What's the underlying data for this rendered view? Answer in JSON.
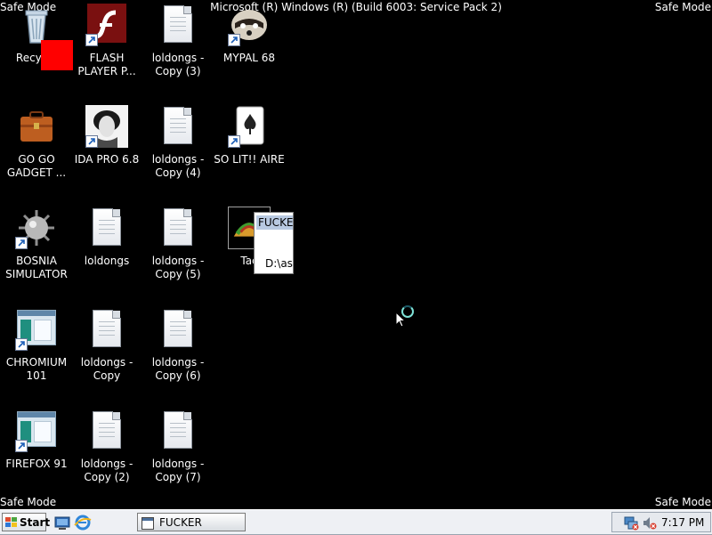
{
  "os": {
    "safe_mode": "Safe Mode",
    "title": "Microsoft (R) Windows (R) (Build 6003: Service Pack 2)"
  },
  "desktop_icons": [
    {
      "label": "Recycle",
      "icon": "recycle-bin-icon"
    },
    {
      "label": "FLASH PLAYER P...",
      "icon": "flash-icon"
    },
    {
      "label": "loldongs - Copy (3)",
      "icon": "document-icon"
    },
    {
      "label": "MYPAL 68",
      "icon": "raccoon-icon"
    },
    {
      "label": "GO GO GADGET ...",
      "icon": "briefcase-icon"
    },
    {
      "label": "IDA PRO 6.8",
      "icon": "ida-icon"
    },
    {
      "label": "loldongs - Copy (4)",
      "icon": "document-icon"
    },
    {
      "label": "SO LIT!! AIRE",
      "icon": "solitaire-icon"
    },
    {
      "label": "BOSNIA SIMULATOR",
      "icon": "mine-icon"
    },
    {
      "label": "loldongs",
      "icon": "document-icon"
    },
    {
      "label": "loldongs - Copy (5)",
      "icon": "document-icon"
    },
    {
      "label": "Tac",
      "icon": "taco-icon"
    },
    {
      "label": "CHROMIUM 101",
      "icon": "browser-window-icon"
    },
    {
      "label": "loldongs - Copy",
      "icon": "document-icon"
    },
    {
      "label": "loldongs - Copy (6)",
      "icon": "document-icon"
    },
    {
      "label": "FIREFOX 91",
      "icon": "browser-window-icon"
    },
    {
      "label": "loldongs - Copy (2)",
      "icon": "document-icon"
    },
    {
      "label": "loldongs - Copy (7)",
      "icon": "document-icon"
    }
  ],
  "tooltip": {
    "title": "FUCKER",
    "path": "D:\\ass"
  },
  "taskbar": {
    "start_label": "Start",
    "window_button_label": "FUCKER",
    "clock": "7:17 PM"
  },
  "colors": {
    "desktop": "#000000",
    "taskbar": "#eef0f4",
    "overlay_red": "#ff0000"
  }
}
